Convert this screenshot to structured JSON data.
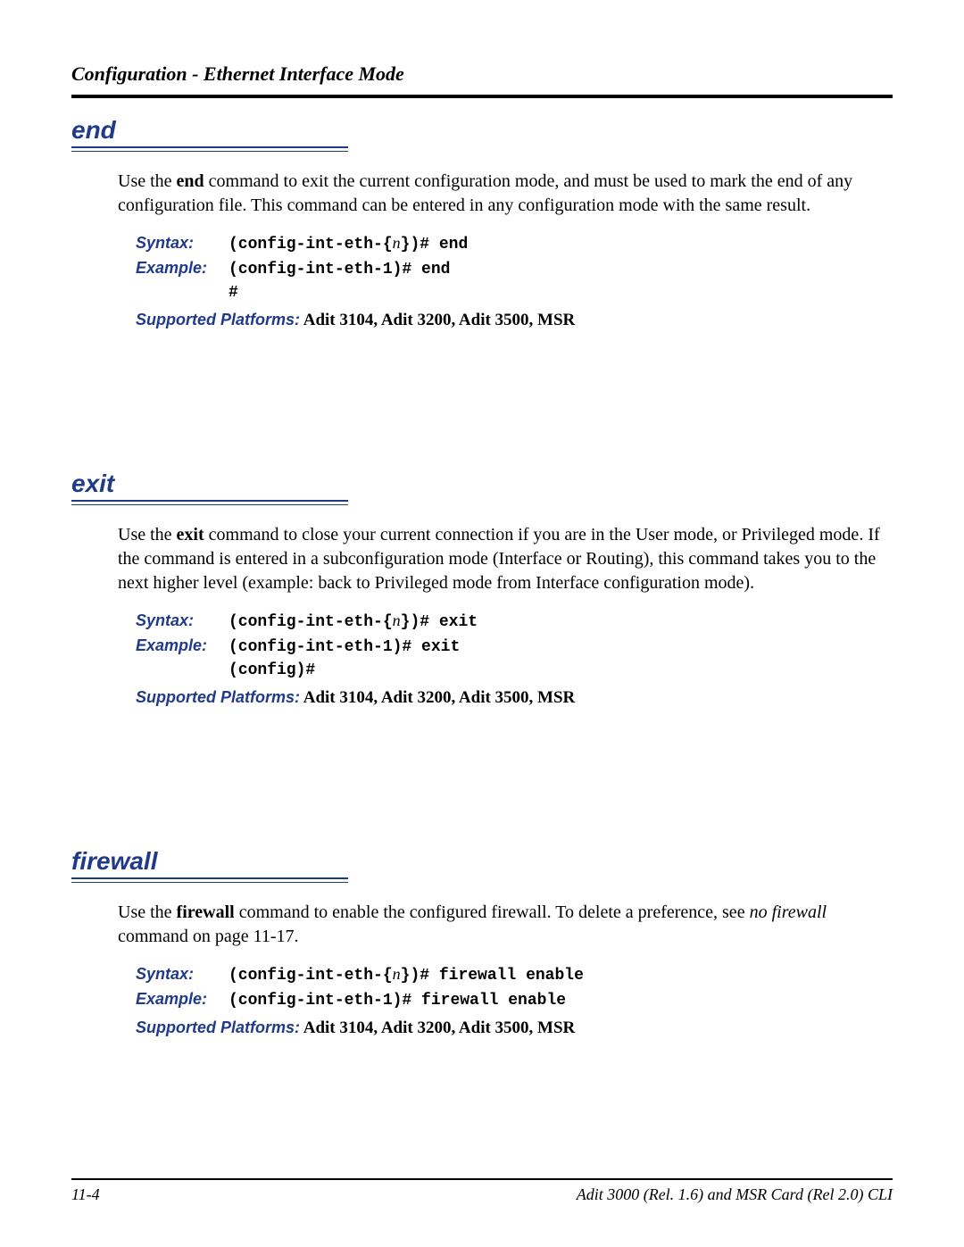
{
  "header": {
    "title": "Configuration - Ethernet Interface Mode"
  },
  "sections": {
    "end": {
      "heading": "end",
      "body_pre": "Use the ",
      "body_bold": "end",
      "body_post": " command to exit the current configuration mode, and must be used to mark the end of any configuration file.  This command can be entered in any configuration mode with the same result.",
      "syntax_label": "Syntax:",
      "syntax_value_pre": "(config-int-eth-{",
      "syntax_var": "n",
      "syntax_value_post": "})# end",
      "example_label": "Example:",
      "example_value": "(config-int-eth-1)# end",
      "example_cont": "#",
      "platforms_label": "Supported Platforms:",
      "platforms_value": "  Adit 3104, Adit 3200, Adit 3500, MSR"
    },
    "exit": {
      "heading": "exit",
      "body_pre": "Use the ",
      "body_bold": "exit",
      "body_post": " command to close your current connection if you are in the User mode, or Privileged mode. If the command is entered in a subconfiguration mode (Interface or Routing), this command takes you to the next higher level (example: back to Privileged mode from Interface configuration mode).",
      "syntax_label": "Syntax:",
      "syntax_value_pre": "(config-int-eth-{",
      "syntax_var": "n",
      "syntax_value_post": "})# exit",
      "example_label": "Example:",
      "example_value": "(config-int-eth-1)# exit",
      "example_cont": "(config)#",
      "platforms_label": "Supported Platforms:",
      "platforms_value": "  Adit 3104, Adit 3200, Adit 3500, MSR"
    },
    "firewall": {
      "heading": "firewall",
      "body_pre": "Use the ",
      "body_bold": "firewall",
      "body_mid": " command to enable the configured firewall. To delete a preference, see ",
      "body_italic": "no firewall",
      "body_post": " command on page 11-17.",
      "syntax_label": "Syntax:",
      "syntax_value_pre": "(config-int-eth-{",
      "syntax_var": "n",
      "syntax_value_post": "})# firewall enable",
      "example_label": "Example:",
      "example_value": "(config-int-eth-1)# firewall enable",
      "platforms_label": "Supported Platforms:",
      "platforms_value": "  Adit 3104, Adit 3200, Adit 3500, MSR"
    }
  },
  "footer": {
    "page": "11-4",
    "doc": "Adit 3000 (Rel. 1.6) and MSR Card (Rel 2.0) CLI"
  }
}
